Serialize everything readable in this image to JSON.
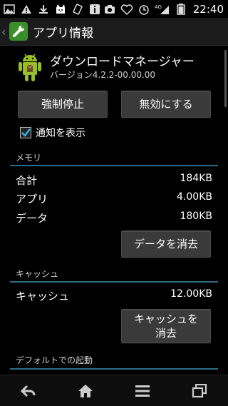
{
  "statusbar": {
    "time": "22:40",
    "network": "4G"
  },
  "actionbar": {
    "title": "アプリ情報"
  },
  "app": {
    "name": "ダウンロードマネージャー",
    "version": "バージョン4.2.2-00.00.00"
  },
  "buttons": {
    "force_stop": "強制停止",
    "disable": "無効にする",
    "clear_data": "データを消去",
    "clear_cache_line1": "キャッシュを",
    "clear_cache_line2": "消去"
  },
  "notifications": {
    "label": "通知を表示",
    "checked": true
  },
  "memory": {
    "title": "メモリ",
    "rows": [
      {
        "label": "合計",
        "value": "184KB"
      },
      {
        "label": "アプリ",
        "value": "4.00KB"
      },
      {
        "label": "データ",
        "value": "180KB"
      }
    ]
  },
  "cache": {
    "title": "キャッシュ",
    "rows": [
      {
        "label": "キャッシュ",
        "value": "12.00KB"
      }
    ]
  },
  "defaults": {
    "title": "デフォルトでの起動"
  },
  "colors": {
    "accent": "#2f6d87",
    "button": "#3a3a3a",
    "actionbar": "#1b1b1b"
  }
}
